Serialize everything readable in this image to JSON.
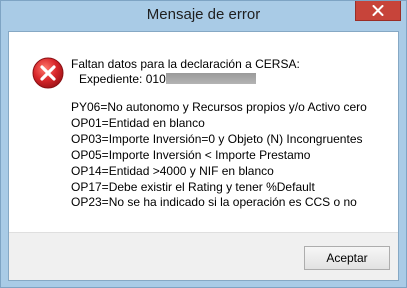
{
  "window": {
    "title": "Mensaje de error"
  },
  "icons": {
    "close": "close-icon",
    "error": "error-icon"
  },
  "message": {
    "heading": "Faltan datos para la declaración a CERSA:",
    "expediente_label": "Expediente: 010",
    "codes": [
      "PY06=No autonomo y Recursos propios y/o Activo cero",
      "OP01=Entidad en blanco",
      "OP03=Importe Inversión=0 y Objeto (N) Incongruentes",
      "OP05=Importe Inversión < Importe Prestamo",
      "OP14=Entidad >4000 y NIF en blanco",
      "OP17=Debe existir el Rating y tener %Default",
      "OP23=No se ha indicado si la operación es CCS o no"
    ]
  },
  "buttons": {
    "accept": "Aceptar"
  },
  "colors": {
    "titlebar": "#a9cbe6",
    "close_button": "#c7443a",
    "error_icon": "#d8262a"
  }
}
